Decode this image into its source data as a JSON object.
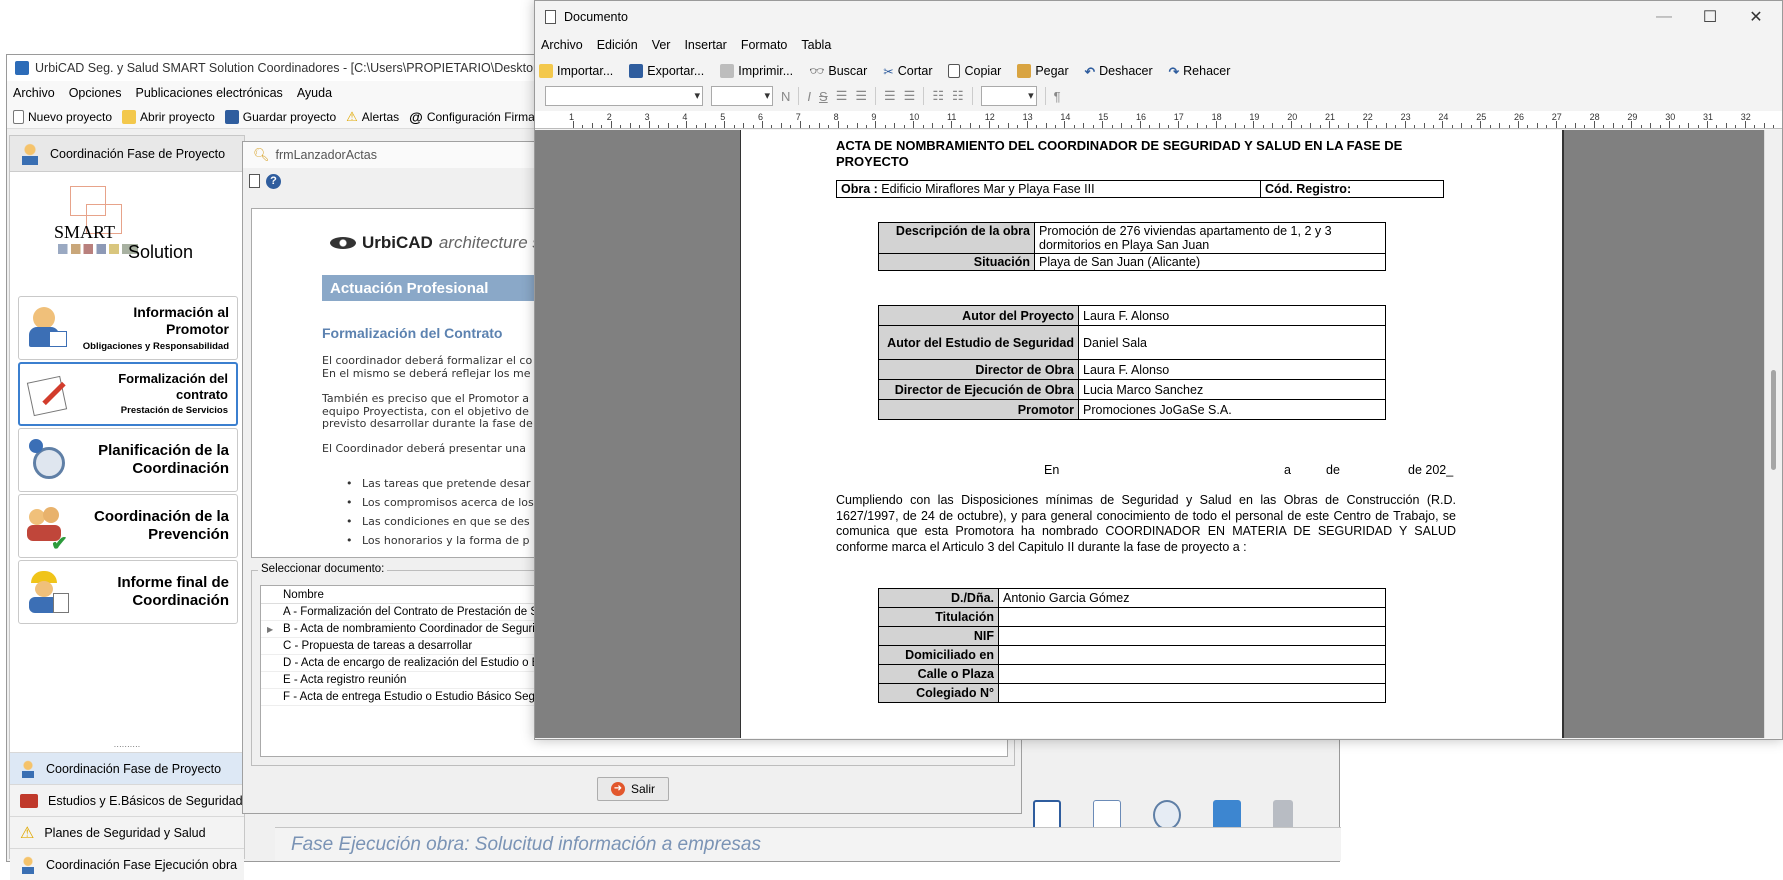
{
  "main_window": {
    "title": "UrbiCAD Seg. y Salud SMART Solution Coordinadores - [C:\\Users\\PROPIETARIO\\Desktop\\Prue",
    "menu": [
      "Archivo",
      "Opciones",
      "Publicaciones electrónicas",
      "Ayuda"
    ],
    "toolbar": [
      "Nuevo proyecto",
      "Abrir proyecto",
      "Guardar proyecto",
      "Alertas",
      "Configuración Firma Digi"
    ],
    "nav_header": "Coordinación Fase de Proyecto",
    "logo": {
      "line1": "SMART",
      "line2": "Solution"
    },
    "nav_buttons": [
      {
        "title": "Información al Promotor",
        "subtitle": "Obligaciones y Responsabilidad"
      },
      {
        "title": "Formalización del contrato",
        "subtitle": "Prestación de Servicios"
      },
      {
        "title": "Planificación de la Coordinación",
        "subtitle": ""
      },
      {
        "title": "Coordinación de la Prevención",
        "subtitle": ""
      },
      {
        "title": "Informe final de Coordinación",
        "subtitle": ""
      }
    ],
    "nav_sections": [
      "Coordinación Fase de Proyecto",
      "Estudios y E.Básicos de Seguridad",
      "Planes de Seguridad y Salud",
      "Coordinación Fase Ejecución obra"
    ],
    "status_text": "Fase Ejecución obra: Solucitud información a empresas"
  },
  "launcher_window": {
    "title": "frmLanzadorActas",
    "preview": {
      "brand": "UrbiCAD",
      "brand_suffix": "architecture s.",
      "section_bar": "Actuación Profesional",
      "heading": "Formalización del Contrato",
      "para1": "El coordinador deberá formalizar el co",
      "para1b": "En el mismo se deberá reflejar los me",
      "para2": "También es preciso que el Promotor a",
      "para2b": "equipo Proyectista, con el objetivo de",
      "para2c": "previsto desarrollar durante la fase de",
      "para3": "El Coordinador deberá presentar una",
      "bullets": [
        "Las tareas que pretende desar",
        "Los compromisos acerca de los",
        "Las condiciones en que se des",
        "Los honorarios y la forma de p"
      ]
    },
    "select_label": "Seleccionar documento:",
    "list_header": "Nombre",
    "documents": [
      "A - Formalización del Contrato de Prestación de Se",
      "B - Acta de nombramiento Coordinador de Segurida",
      "C - Propuesta de tareas a desarrollar",
      "D - Acta de encargo de realización del Estudio o Es",
      "E - Acta registro reunión",
      "F - Acta de entrega Estudio o Estudio Básico Segur"
    ],
    "selected_index": 1,
    "exit_button": "Salir"
  },
  "document_window": {
    "title": "Documento",
    "controls": {
      "minimize": "—",
      "maximize": "☐",
      "close": "✕"
    },
    "menu": [
      "Archivo",
      "Edición",
      "Ver",
      "Insertar",
      "Formato",
      "Tabla"
    ],
    "toolbar": [
      "Importar...",
      "Exportar...",
      "Imprimir...",
      "Buscar",
      "Cortar",
      "Copiar",
      "Pegar",
      "Deshacer",
      "Rehacer"
    ],
    "format_glyphs": {
      "bold": "N",
      "italic": "I",
      "strike": "S",
      "para": "¶"
    },
    "ruler_numbers": [
      "1",
      "2",
      "3",
      "4",
      "5",
      "6",
      "7",
      "8",
      "9",
      "10",
      "11",
      "12",
      "13",
      "14",
      "15",
      "16",
      "17",
      "18",
      "19",
      "20",
      "21",
      "22",
      "23",
      "24",
      "25",
      "26",
      "27",
      "28",
      "29",
      "30",
      "31",
      "32"
    ],
    "doc": {
      "title": "ACTA DE NOMBRAMIENTO DEL COORDINADOR DE SEGURIDAD Y SALUD EN LA FASE DE PROYECTO",
      "obra_label": "Obra :",
      "obra_value": "Edificio Miraflores Mar y Playa Fase III",
      "registro_label": "Cód. Registro:",
      "registro_value": "",
      "descripcion_label": "Descripción de la obra",
      "descripcion_value": "Promoción de 276 viviendas apartamento de 1, 2 y 3 dormitorios en Playa San Juan",
      "situacion_label": "Situación",
      "situacion_value": "Playa de San Juan (Alicante)",
      "autores": [
        {
          "label": "Autor del Proyecto",
          "value": "Laura F. Alonso"
        },
        {
          "label": "Autor del Estudio de Seguridad",
          "value": "Daniel Sala"
        },
        {
          "label": "Director de Obra",
          "value": "Laura F. Alonso"
        },
        {
          "label": "Director de Ejecución de Obra",
          "value": "Lucia Marco Sanchez"
        },
        {
          "label": "Promotor",
          "value": "Promociones JoGaSe S.A."
        }
      ],
      "date_en": "En",
      "date_a": "a",
      "date_de": "de",
      "date_year": "de 202_",
      "body": "Cumpliendo con las Disposiciones mínimas de Seguridad y Salud en las Obras de Construcción (R.D. 1627/1997, de 24 de octubre), y para general conocimiento de todo el personal de este Centro de Trabajo, se comunica que esta Promotora ha nombrado COORDINADOR EN MATERIA DE SEGURIDAD Y SALUD conforme marca el Articulo 3 del Capitulo II durante la fase de proyecto a :",
      "coordinador": [
        {
          "label": "D./Dña.",
          "value": "Antonio Garcia Gómez"
        },
        {
          "label": "Titulación",
          "value": ""
        },
        {
          "label": "NIF",
          "value": ""
        },
        {
          "label": "Domiciliado en",
          "value": ""
        },
        {
          "label": "Calle o Plaza",
          "value": ""
        },
        {
          "label": "Colegiado N°",
          "value": ""
        }
      ]
    }
  },
  "colors": {
    "accent_blue": "#3b7fcf",
    "section_bar": "#8aa8c8",
    "heading_blue": "#5c82b0",
    "label_gray": "#d3d3d3",
    "doc_background": "#808080"
  }
}
